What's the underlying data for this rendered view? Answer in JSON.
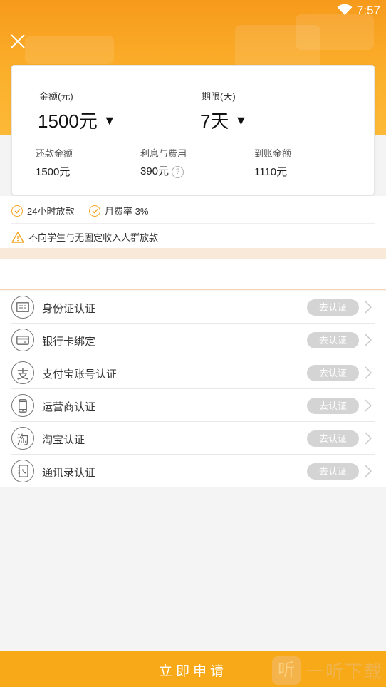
{
  "status_bar": {
    "time": "7:57"
  },
  "loan_card": {
    "amount_label": "金额(元)",
    "amount_value": "1500元",
    "term_label": "期限(天)",
    "term_value": "7天",
    "repay_label": "还款金额",
    "repay_value": "1500元",
    "fee_label": "利息与费用",
    "fee_value": "390元",
    "receive_label": "到账金额",
    "receive_value": "1110元"
  },
  "features": {
    "fast_loan": "24小时放款",
    "monthly_rate": "月费率 3%",
    "warning": "不向学生与无固定收入人群放款"
  },
  "verifications": [
    {
      "label": "身份证认证",
      "action": "去认证",
      "icon": "id-card-icon"
    },
    {
      "label": "银行卡绑定",
      "action": "去认证",
      "icon": "bank-card-icon"
    },
    {
      "label": "支付宝账号认证",
      "action": "去认证",
      "icon": "alipay-icon"
    },
    {
      "label": "运营商认证",
      "action": "去认证",
      "icon": "phone-icon"
    },
    {
      "label": "淘宝认证",
      "action": "去认证",
      "icon": "taobao-icon"
    },
    {
      "label": "通讯录认证",
      "action": "去认证",
      "icon": "contacts-icon"
    }
  ],
  "bottom": {
    "apply_label": "立即申请"
  },
  "watermark": {
    "glyph": "听",
    "text": "一听下载"
  },
  "colors": {
    "accent": "#f8a918",
    "button_gray": "#d4d4d4",
    "band": "#f9e9d9"
  }
}
